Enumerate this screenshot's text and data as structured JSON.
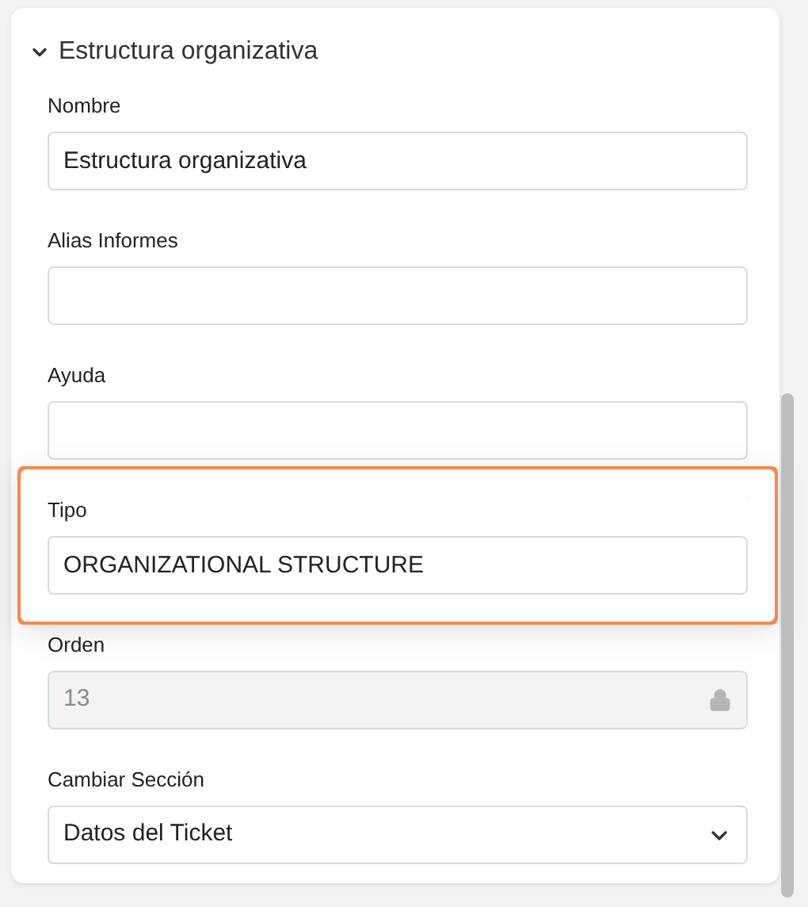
{
  "section": {
    "title": "Estructura organizativa",
    "expanded": true
  },
  "fields": [
    {
      "label": "Nombre",
      "kind": "text",
      "value": "Estructura organizativa",
      "highlighted": false
    },
    {
      "label": "Alias Informes",
      "kind": "text",
      "highlighted": false
    },
    {
      "label": "Ayuda",
      "kind": "text",
      "highlighted": false
    },
    {
      "label": "Tipo",
      "kind": "text",
      "value": "ORGANIZATIONAL STRUCTURE",
      "highlighted": true
    },
    {
      "label": "Orden",
      "kind": "locked",
      "value": "13",
      "highlighted": false
    },
    {
      "label": "Cambiar Sección",
      "kind": "select",
      "value": "Datos del Ticket",
      "highlighted": false
    }
  ]
}
